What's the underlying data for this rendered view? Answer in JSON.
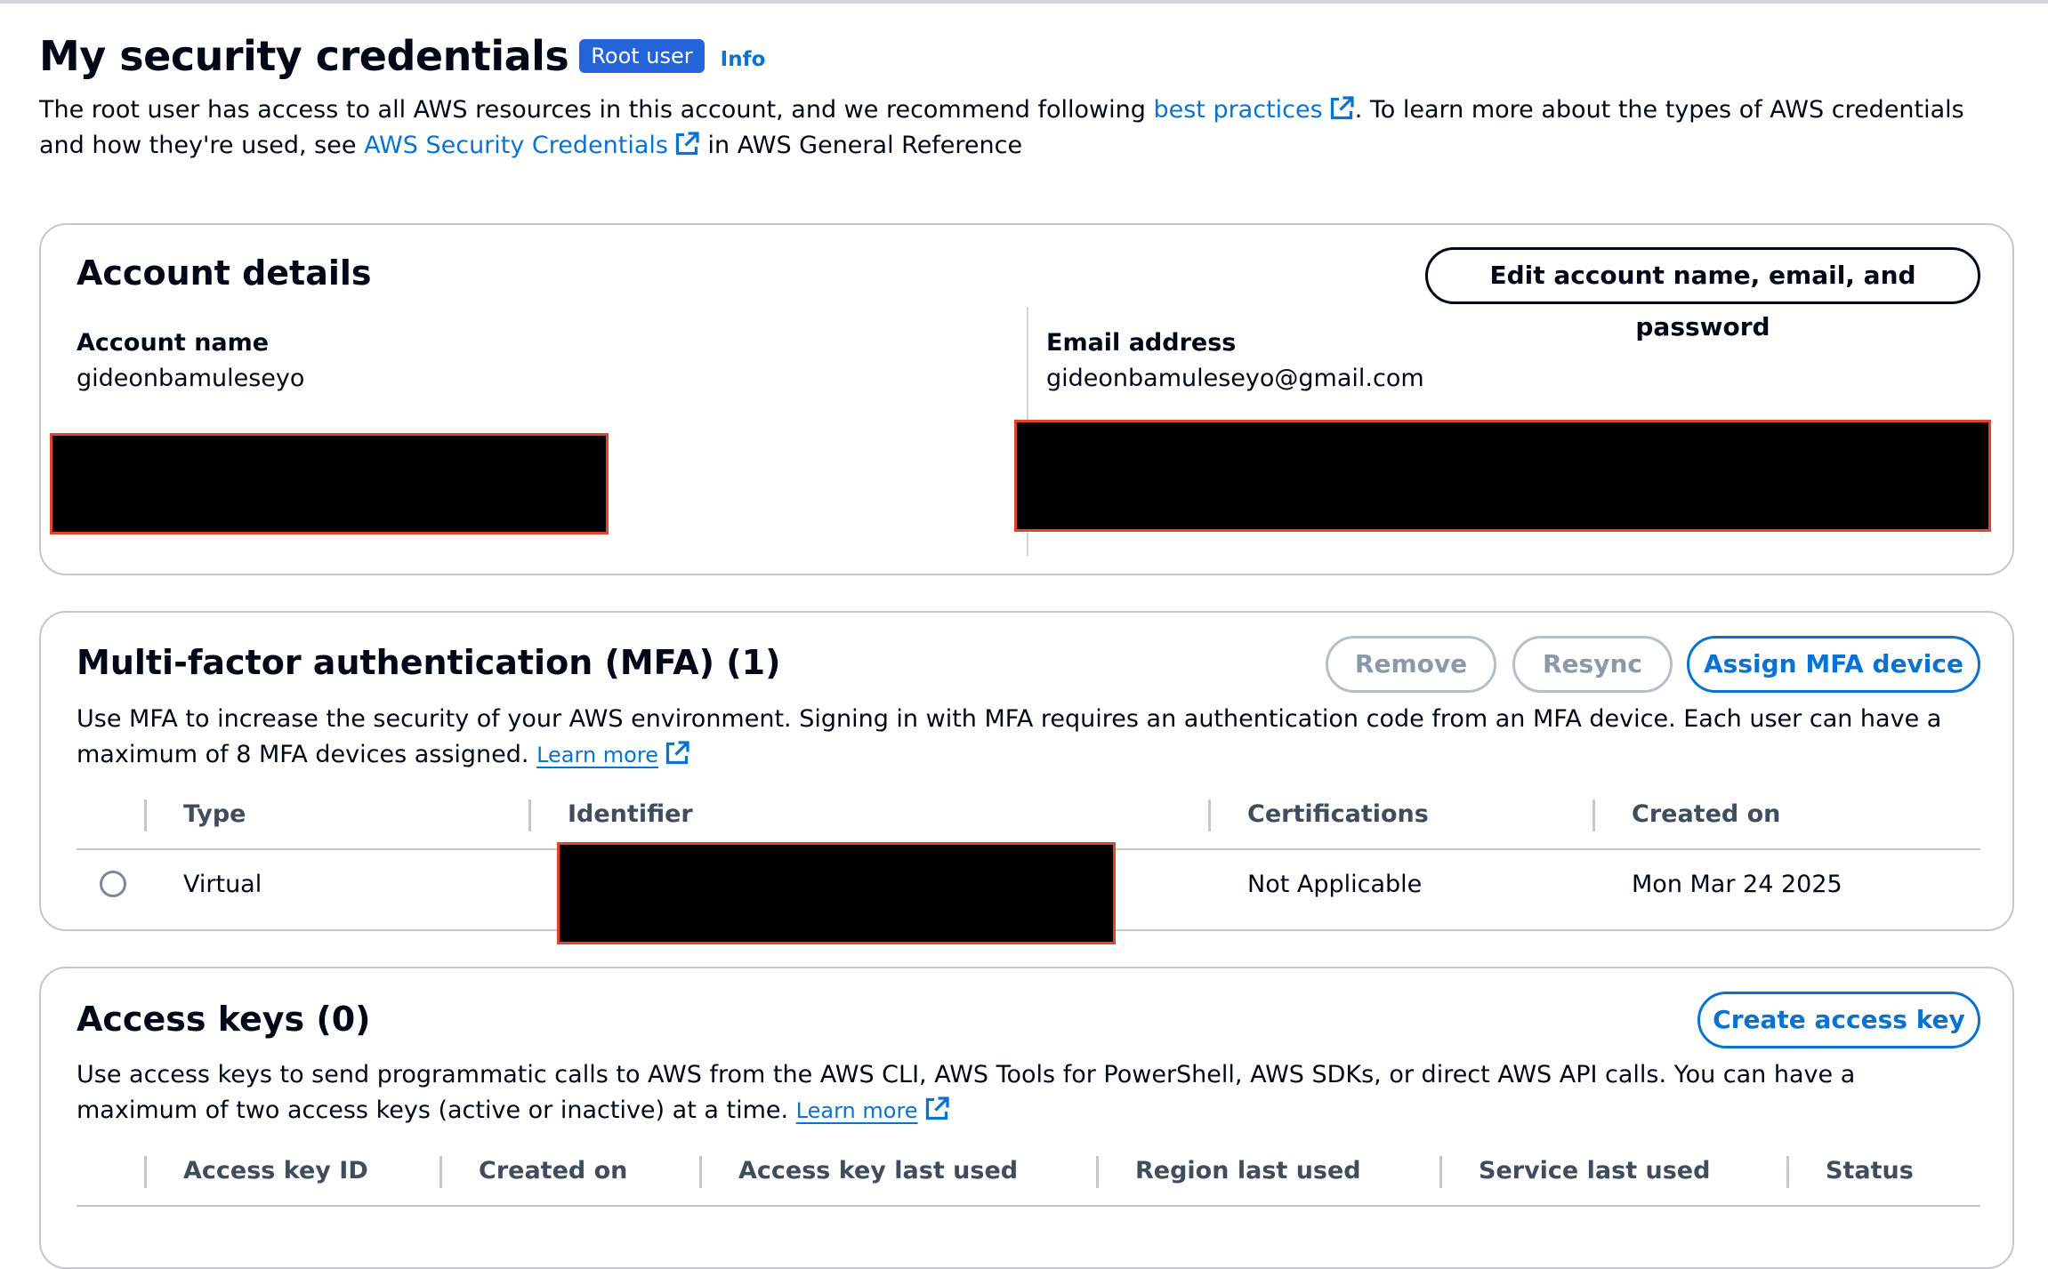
{
  "header": {
    "title": "My security credentials",
    "badge": "Root user",
    "info": "Info",
    "desc_part1": "The root user has access to all AWS resources in this account, and we recommend following ",
    "desc_link1": "best practices",
    "desc_part2": ". To learn more about the types of AWS credentials and how they're used, see ",
    "desc_link2": "AWS Security Credentials",
    "desc_part3": " in AWS General Reference"
  },
  "account": {
    "title": "Account details",
    "edit_button": "Edit account name, email, and password",
    "name_label": "Account name",
    "name_value": "gideonbamuleseyo",
    "email_label": "Email address",
    "email_value": "gideonbamuleseyo@gmail.com"
  },
  "mfa": {
    "title": "Multi-factor authentication (MFA) (1)",
    "remove_button": "Remove",
    "resync_button": "Resync",
    "assign_button": "Assign MFA device",
    "desc": "Use MFA to increase the security of your AWS environment. Signing in with MFA requires an authentication code from an MFA device. Each user can have a maximum of 8 MFA devices assigned. ",
    "learn_more": "Learn more",
    "columns": [
      "Type",
      "Identifier",
      "Certifications",
      "Created on"
    ],
    "rows": [
      {
        "type": "Virtual",
        "identifier": "",
        "certifications": "Not Applicable",
        "created_on": "Mon Mar 24 2025"
      }
    ]
  },
  "access_keys": {
    "title": "Access keys (0)",
    "create_button": "Create access key",
    "desc": "Use access keys to send programmatic calls to AWS from the AWS CLI, AWS Tools for PowerShell, AWS SDKs, or direct AWS API calls. You can have a maximum of two access keys (active or inactive) at a time. ",
    "learn_more": "Learn more",
    "columns": [
      "Access key ID",
      "Created on",
      "Access key last used",
      "Region last used",
      "Service last used",
      "Status"
    ]
  },
  "colors": {
    "link": "#0972d3",
    "badge": "#2563d8",
    "redaction_border": "#e0452b",
    "text": "#000716"
  },
  "icons": {
    "external_link": "external-link-icon",
    "radio": "radio-button"
  }
}
